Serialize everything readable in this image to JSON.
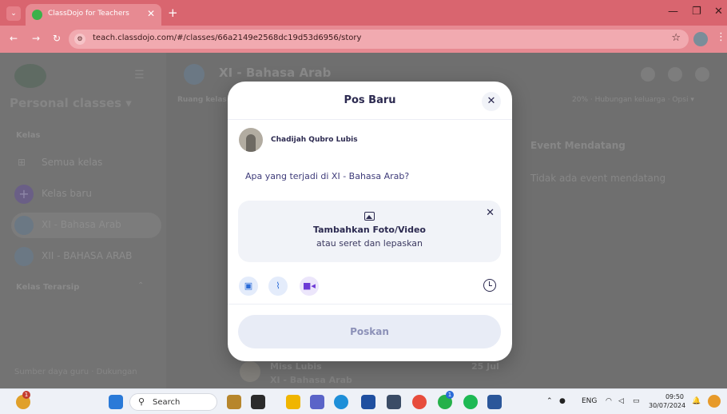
{
  "browser": {
    "tab_title": "ClassDojo for Teachers",
    "url": "teach.classdojo.com/#/classes/66a2149e2568dc19d53d6956/story"
  },
  "sidebar": {
    "header": "Personal classes ▾",
    "section_classes": "Kelas",
    "items": [
      {
        "label": "Semua kelas",
        "icon": "grid-icon"
      },
      {
        "label": "Kelas baru",
        "icon": "plus-icon"
      },
      {
        "label": "XI - Bahasa Arab",
        "icon": "class-avatar-icon"
      },
      {
        "label": "XII - BAHASA ARAB",
        "icon": "class-avatar-icon"
      }
    ],
    "section_archived": "Kelas Terarsip",
    "footer_resources": "Sumber daya guru",
    "footer_separator": "·",
    "footer_support": "Dukungan"
  },
  "class_header": {
    "title": "XI - Bahasa Arab",
    "tab_partial": "Ruang kelas",
    "family_connections": "20% · Hubungan keluarga · Opsi ▾"
  },
  "events": {
    "title": "Event Mendatang",
    "empty": "Tidak ada event mendatang"
  },
  "post_preview": {
    "author": "Miss Lubis",
    "class": "XI - Bahasa Arab",
    "date": "25 Jul"
  },
  "modal": {
    "title": "Pos Baru",
    "close_glyph": "✕",
    "author_name": "Chadijah Qubro Lubis",
    "prompt": "Apa yang terjadi di XI - Bahasa Arab?",
    "dropzone_title": "Tambahkan Foto/Video",
    "dropzone_sub": "atau seret dan lepaskan",
    "dropzone_close_glyph": "✕",
    "post_button": "Poskan"
  },
  "taskbar": {
    "search_placeholder": "Search",
    "chrome_badge": "1",
    "whatsapp_badge": "1",
    "lang": "ENG",
    "time": "09:50",
    "date": "30/07/2024"
  },
  "colors": {
    "browser_tab": "#d9656f",
    "modal_title": "#2c2a50",
    "prompt_text": "#3f3c7a",
    "post_button_bg": "#e8ecf6"
  }
}
